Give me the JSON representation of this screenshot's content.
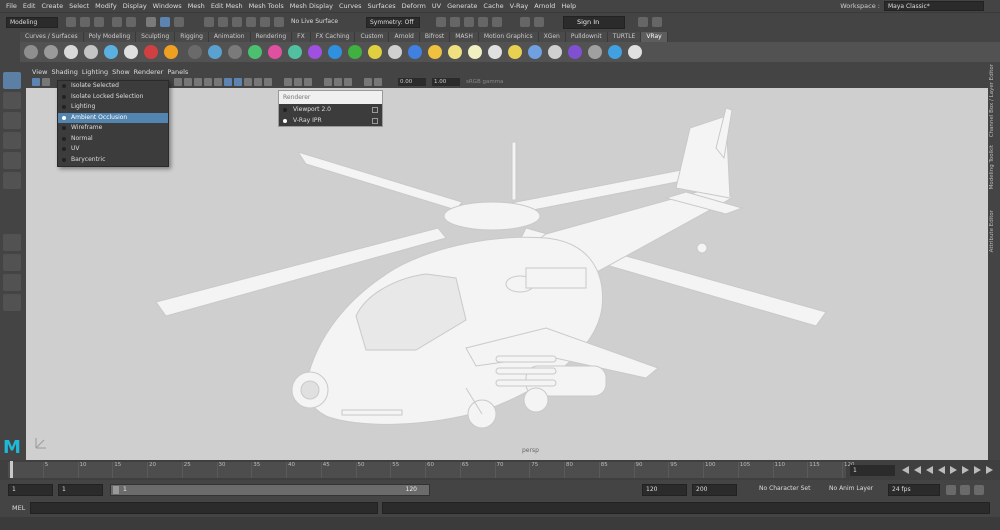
{
  "menubar": {
    "items": [
      "File",
      "Edit",
      "Create",
      "Select",
      "Modify",
      "Display",
      "Windows",
      "Mesh",
      "Edit Mesh",
      "Mesh Tools",
      "Mesh Display",
      "Curves",
      "Surfaces",
      "Deform",
      "UV",
      "Generate",
      "Cache",
      "V-Ray",
      "Arnold",
      "Help"
    ],
    "workspace_label": "Workspace :",
    "workspace_value": "Maya Classic*"
  },
  "statusline": {
    "mode": "Modeling",
    "live_surface": "No Live Surface",
    "symmetry": "Symmetry: Off",
    "sign_in": "Sign In"
  },
  "shelf": {
    "tabs": [
      "Curves / Surfaces",
      "Poly Modeling",
      "Sculpting",
      "Rigging",
      "Animation",
      "Rendering",
      "FX",
      "FX Caching",
      "Custom",
      "Arnold",
      "Bifrost",
      "MASH",
      "Motion Graphics",
      "XGen",
      "Pulldownit",
      "TURTLE",
      "VRay"
    ],
    "active_tab": "VRay"
  },
  "panel": {
    "menus": [
      "View",
      "Shading",
      "Lighting",
      "Show",
      "Renderer",
      "Panels"
    ],
    "field_a": "0.00",
    "field_b": "1.00",
    "color_space": "sRGB gamma",
    "camera_label": "persp"
  },
  "shading_menu": {
    "items": [
      "Isolate Selected",
      "Isolate Locked Selection",
      "Lighting",
      "Ambient Occlusion",
      "Wireframe",
      "Normal",
      "UV",
      "Barycentric"
    ],
    "highlighted_index": 3
  },
  "renderer_menu": {
    "title": "Renderer",
    "items": [
      {
        "label": "Viewport 2.0",
        "selected": false
      },
      {
        "label": "V-Ray IPR",
        "selected": true
      }
    ]
  },
  "right_panel": {
    "labels": [
      "Channel Box / Layer Editor",
      "Modeling Toolkit",
      "Attribute Editor"
    ]
  },
  "timeline": {
    "ticks": [
      "5",
      "10",
      "15",
      "20",
      "25",
      "30",
      "35",
      "40",
      "45",
      "50",
      "55",
      "60",
      "65",
      "70",
      "75",
      "80",
      "85",
      "90",
      "95",
      "100",
      "105",
      "110",
      "115",
      "120"
    ],
    "current_frame": "1"
  },
  "range": {
    "start": "1",
    "anim_start": "1",
    "inner_start": "1",
    "inner_end": "120",
    "end": "120",
    "anim_end": "200",
    "character_set": "No Character Set",
    "anim_layer": "No Anim Layer",
    "fps": "24 fps"
  },
  "command": {
    "label": "MEL"
  },
  "icons": [
    "select-tool-icon",
    "lasso-icon",
    "paint-icon",
    "move-icon",
    "rotate-icon",
    "scale-icon",
    "play-forward-icon",
    "step-back-icon"
  ]
}
